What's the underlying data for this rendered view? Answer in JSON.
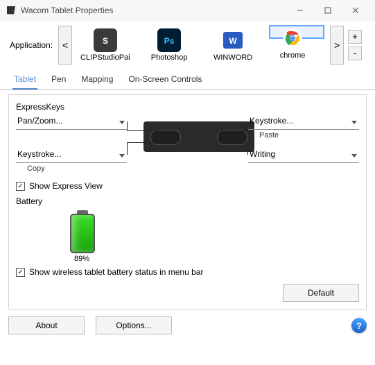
{
  "window": {
    "title": "Wacom Tablet Properties"
  },
  "appRow": {
    "label": "Application:",
    "prev": "<",
    "next": ">",
    "plus": "+",
    "minus": "-",
    "apps": [
      {
        "name": "CLIPStudioPaint",
        "selected": false,
        "iconColor": "#3a3a3a"
      },
      {
        "name": "Photoshop",
        "selected": false,
        "iconColor": "#001d33"
      },
      {
        "name": "WINWORD",
        "selected": false,
        "iconColor": "#2a5bbf"
      },
      {
        "name": "chrome",
        "selected": true,
        "iconColor": "#ffffff"
      }
    ]
  },
  "tabs": {
    "items": [
      "Tablet",
      "Pen",
      "Mapping",
      "On-Screen Controls"
    ],
    "active": 0
  },
  "expressKeys": {
    "title": "ExpressKeys",
    "leftTop": {
      "value": "Pan/Zoom...",
      "sub": ""
    },
    "leftBottom": {
      "value": "Keystroke...",
      "sub": "Copy"
    },
    "rightTop": {
      "value": "Keystroke...",
      "sub": "Paste"
    },
    "rightBottom": {
      "value": "Writing",
      "sub": ""
    },
    "showExpressView": {
      "label": "Show Express View",
      "checked": true
    }
  },
  "battery": {
    "title": "Battery",
    "percentText": "89%",
    "showStatus": {
      "label": "Show wireless tablet battery status in menu bar",
      "checked": true
    }
  },
  "buttons": {
    "default": "Default",
    "about": "About",
    "options": "Options..."
  }
}
